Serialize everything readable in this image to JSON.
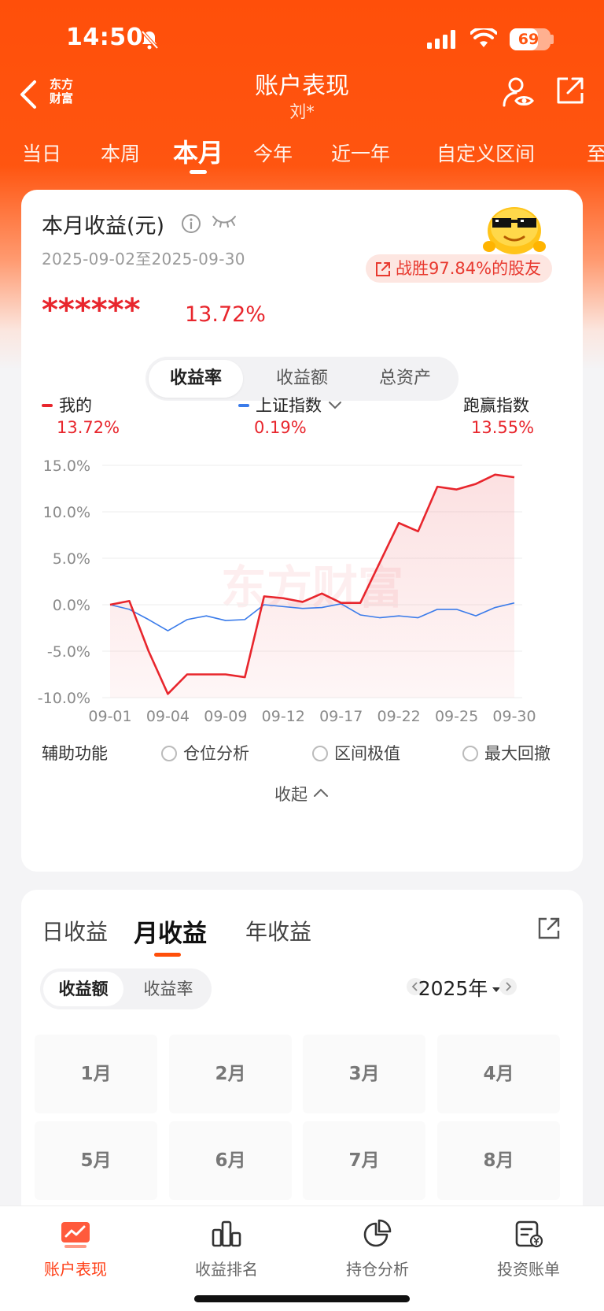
{
  "status": {
    "time": "14:50",
    "battery": "69",
    "battery_level": 0.69
  },
  "header": {
    "title": "账户表现",
    "subtitle": "刘*",
    "logo_line1": "东方",
    "logo_line2": "财富"
  },
  "period_tabs": [
    {
      "label": "当日",
      "active": false
    },
    {
      "label": "本周",
      "active": false
    },
    {
      "label": "本月",
      "active": true
    },
    {
      "label": "今年",
      "active": false
    },
    {
      "label": "近一年",
      "active": false
    },
    {
      "label": "自定义区间",
      "active": false
    },
    {
      "label": "至",
      "active": false
    }
  ],
  "summary": {
    "title": "本月收益(元)",
    "date_range": "2025-09-02至2025-09-30",
    "beat_text": "战胜97.84%的股友",
    "hidden_amount": "******",
    "profit_rate": "13.72%"
  },
  "chart_tabs": [
    {
      "label": "收益率",
      "active": true
    },
    {
      "label": "收益额",
      "active": false
    },
    {
      "label": "总资产",
      "active": false
    }
  ],
  "legend": {
    "mine": {
      "label": "我的",
      "value": "13.72%",
      "color": "#e8262d"
    },
    "index": {
      "label": "上证指数",
      "value": "0.19%",
      "color": "#3a7bea"
    },
    "beat": {
      "label": "跑赢指数",
      "value": "13.55%"
    }
  },
  "chart_data": {
    "type": "line",
    "x": [
      "09-01",
      "09-02",
      "09-03",
      "09-04",
      "09-05",
      "09-08",
      "09-09",
      "09-10",
      "09-11",
      "09-12",
      "09-15",
      "09-16",
      "09-17",
      "09-18",
      "09-19",
      "09-22",
      "09-23",
      "09-24",
      "09-25",
      "09-26",
      "09-29",
      "09-30"
    ],
    "x_tick_labels": [
      "09-01",
      "09-04",
      "09-09",
      "09-12",
      "09-17",
      "09-22",
      "09-25",
      "09-30"
    ],
    "y_tick_labels": [
      "15.0%",
      "10.0%",
      "5.0%",
      "0.0%",
      "-5.0%",
      "-10.0%"
    ],
    "ylim": [
      -10,
      15
    ],
    "grid": true,
    "watermark": "东方财富",
    "series": [
      {
        "name": "我的",
        "color": "#e8262d",
        "values": [
          0.0,
          0.4,
          -5.0,
          -9.6,
          -7.5,
          -7.5,
          -7.5,
          -7.8,
          0.9,
          0.7,
          0.3,
          1.2,
          0.2,
          0.2,
          4.5,
          8.8,
          7.9,
          12.7,
          12.4,
          13.0,
          14.0,
          13.72
        ]
      },
      {
        "name": "上证指数",
        "color": "#3a7bea",
        "values": [
          0.0,
          -0.5,
          -1.6,
          -2.8,
          -1.6,
          -1.2,
          -1.7,
          -1.6,
          0.0,
          -0.2,
          -0.4,
          -0.3,
          0.1,
          -1.1,
          -1.4,
          -1.2,
          -1.4,
          -0.5,
          -0.5,
          -1.2,
          -0.3,
          0.19
        ]
      }
    ]
  },
  "aux": {
    "label": "辅助功能",
    "options": [
      "仓位分析",
      "区间极值",
      "最大回撤"
    ],
    "collapse": "收起"
  },
  "earnings": {
    "tabs": [
      {
        "label": "日收益",
        "active": false
      },
      {
        "label": "月收益",
        "active": true
      },
      {
        "label": "年收益",
        "active": false
      }
    ],
    "toggle": [
      {
        "label": "收益额",
        "active": true
      },
      {
        "label": "收益率",
        "active": false
      }
    ],
    "year": "2025年",
    "months": [
      "1月",
      "2月",
      "3月",
      "4月",
      "5月",
      "6月",
      "7月",
      "8月"
    ]
  },
  "bottom_nav": [
    {
      "label": "账户表现",
      "icon": "chart-screen-icon",
      "active": true
    },
    {
      "label": "收益排名",
      "icon": "bar-chart-icon",
      "active": false
    },
    {
      "label": "持仓分析",
      "icon": "pie-chart-icon",
      "active": false
    },
    {
      "label": "投资账单",
      "icon": "bill-icon",
      "active": false
    }
  ]
}
